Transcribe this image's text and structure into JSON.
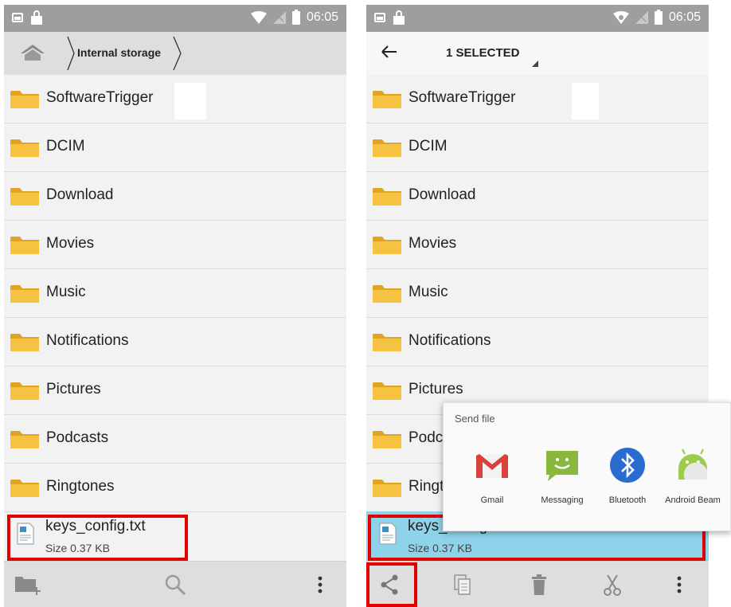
{
  "status_bar": {
    "time": "06:05"
  },
  "left_screen": {
    "breadcrumb": "Internal storage",
    "folders": [
      "SoftwareTrigger",
      "DCIM",
      "Download",
      "Movies",
      "Music",
      "Notifications",
      "Pictures",
      "Podcasts",
      "Ringtones"
    ],
    "file": {
      "name": "keys_config.txt",
      "size": "Size 0.37 KB"
    }
  },
  "right_screen": {
    "title": "1 SELECTED",
    "folders": [
      "SoftwareTrigger",
      "DCIM",
      "Download",
      "Movies",
      "Music",
      "Notifications",
      "Pictures",
      "Podcasts",
      "Ringtones"
    ],
    "file": {
      "name": "keys_config.txt",
      "size": "Size 0.37 KB"
    },
    "send_file": {
      "title": "Send file",
      "apps": [
        {
          "label": "Gmail",
          "icon": "gmail-icon"
        },
        {
          "label": "Messaging",
          "icon": "messaging-icon"
        },
        {
          "label": "Bluetooth",
          "icon": "bluetooth-icon"
        },
        {
          "label": "Android Beam",
          "icon": "android-beam-icon"
        }
      ]
    }
  },
  "colors": {
    "highlight": "#e00000",
    "selected_row": "#8fd3ea",
    "accent": "#4a9d8f",
    "folder": "#f5c242"
  }
}
